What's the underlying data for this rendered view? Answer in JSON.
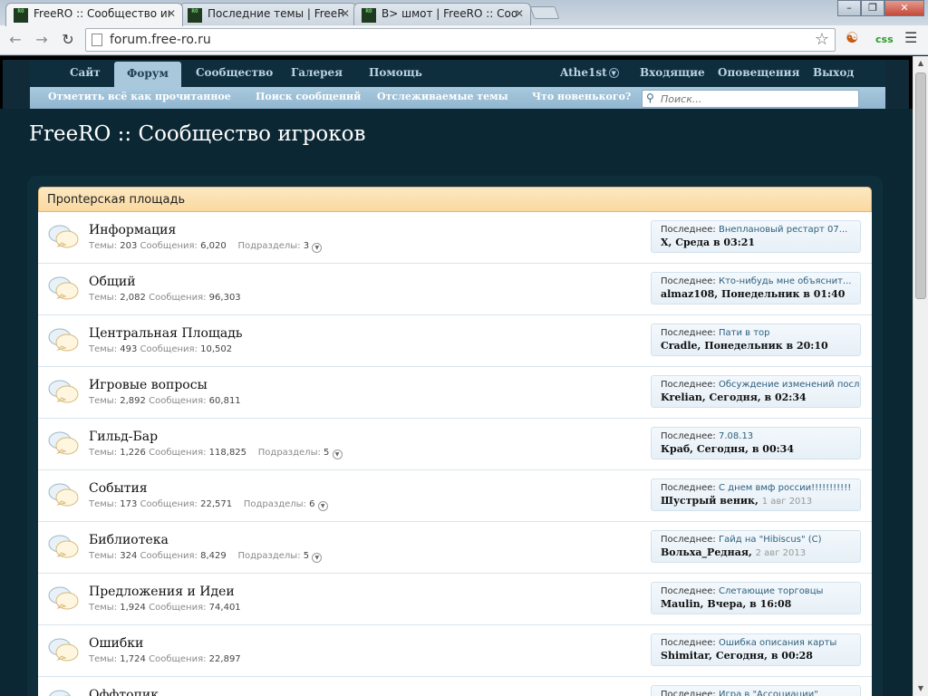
{
  "browser": {
    "tabs": [
      {
        "title": "FreeRO :: Сообщество иг",
        "active": true
      },
      {
        "title": "Последние темы | FreeR(",
        "active": false
      },
      {
        "title": "В> шмот | FreeRO :: Сооб",
        "active": false
      }
    ],
    "favicon_text": "RO",
    "url": "forum.free-ro.ru",
    "ext_css_label": "css"
  },
  "nav": {
    "primary": [
      "Сайт",
      "Форум",
      "Сообщество",
      "Галерея",
      "Помощь"
    ],
    "selected": "Форум",
    "user": "Athe1st",
    "account": [
      "Входящие",
      "Оповещения",
      "Выход"
    ],
    "secondary": [
      "Отметить всё как прочитанное",
      "Поиск сообщений",
      "Отслеживаемые темы",
      "Что новенького?"
    ],
    "search_placeholder": "Поиск..."
  },
  "site_title": "FreeRO :: Сообщество игроков",
  "category": "Прontерская площадь",
  "labels": {
    "threads": "Темы:",
    "messages": "Сообщения:",
    "subforums": "Подразделы:",
    "last": "Последнее:"
  },
  "forums": [
    {
      "name": "Информация",
      "threads": "203",
      "messages": "6,020",
      "subforums": "3",
      "last_title": "Внеплановый рестарт 07...",
      "last_user": "X",
      "last_when": ", Среда в 03:21",
      "last_date": ""
    },
    {
      "name": "Общий",
      "threads": "2,082",
      "messages": "96,303",
      "subforums": "",
      "last_title": "Кто-нибудь мне объяснит...",
      "last_user": "almaz108",
      "last_when": ", Понедельник в 01:40",
      "last_date": ""
    },
    {
      "name": "Центральная Площадь",
      "threads": "493",
      "messages": "10,502",
      "subforums": "",
      "last_title": "Пати в тор",
      "last_user": "Cradle",
      "last_when": ", Понедельник в 20:10",
      "last_date": ""
    },
    {
      "name": "Игровые вопросы",
      "threads": "2,892",
      "messages": "60,811",
      "subforums": "",
      "last_title": "Обсуждение изменений после...",
      "last_user": "Krelian",
      "last_when": ", Сегодня, в 02:34",
      "last_date": ""
    },
    {
      "name": "Гильд-Бар",
      "threads": "1,226",
      "messages": "118,825",
      "subforums": "5",
      "last_title": "7.08.13",
      "last_user": "Краб",
      "last_when": ", Сегодня, в 00:34",
      "last_date": ""
    },
    {
      "name": "События",
      "threads": "173",
      "messages": "22,571",
      "subforums": "6",
      "last_title": "С днем вмф россии!!!!!!!!!!!",
      "last_user": "Шустрый веник",
      "last_when": ",",
      "last_date": "1 авг 2013"
    },
    {
      "name": "Библиотека",
      "threads": "324",
      "messages": "8,429",
      "subforums": "5",
      "last_title": "Гайд на \"Hibiscus\" (C)",
      "last_user": "Вольха_Редная",
      "last_when": ",",
      "last_date": "2 авг 2013"
    },
    {
      "name": "Предложения и Идеи",
      "threads": "1,924",
      "messages": "74,401",
      "subforums": "",
      "last_title": "Слетающие торговцы",
      "last_user": "Maulin",
      "last_when": ", Вчера, в 16:08",
      "last_date": ""
    },
    {
      "name": "Ошибки",
      "threads": "1,724",
      "messages": "22,897",
      "subforums": "",
      "last_title": "Ошибка описания карты",
      "last_user": "Shimitar",
      "last_when": ", Сегодня, в 00:28",
      "last_date": ""
    },
    {
      "name": "Оффтопик",
      "threads": "",
      "messages": "",
      "subforums": "",
      "last_title": "Игра в \"Ассоциации\"",
      "last_user": "",
      "last_when": "",
      "last_date": ""
    }
  ],
  "colors": {
    "page_bg": "#0b2733",
    "nav_selected": "#a9c8dc",
    "category_header": "#f9d9a0",
    "link": "#2b5f7e"
  }
}
